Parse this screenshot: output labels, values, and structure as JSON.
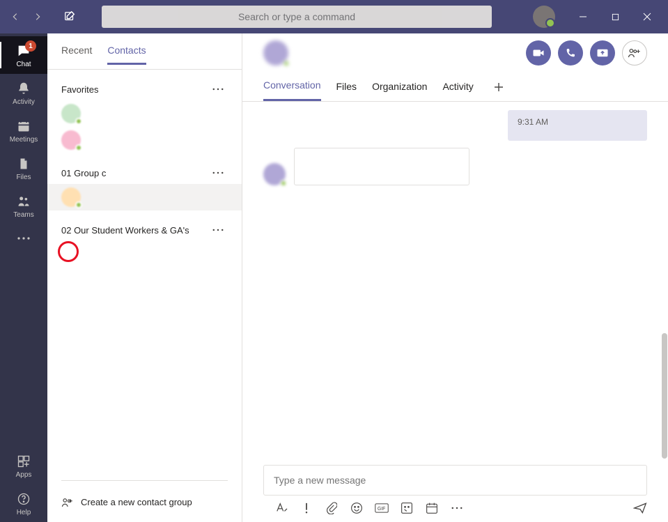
{
  "titlebar": {
    "search_placeholder": "Search or type a command"
  },
  "leftrail": {
    "chat": "Chat",
    "chat_badge": "1",
    "activity": "Activity",
    "meetings": "Meetings",
    "files": "Files",
    "teams": "Teams",
    "apps": "Apps",
    "help": "Help"
  },
  "list": {
    "tab_recent": "Recent",
    "tab_contacts": "Contacts",
    "favorites": "Favorites",
    "group1": "01 Group c",
    "group2": "02 Our Student Workers & GA's",
    "create_group": "Create a new contact group"
  },
  "conv": {
    "tab_conversation": "Conversation",
    "tab_files": "Files",
    "tab_org": "Organization",
    "tab_activity": "Activity",
    "msg_time": "9:31 AM",
    "compose_placeholder": "Type a new message"
  }
}
